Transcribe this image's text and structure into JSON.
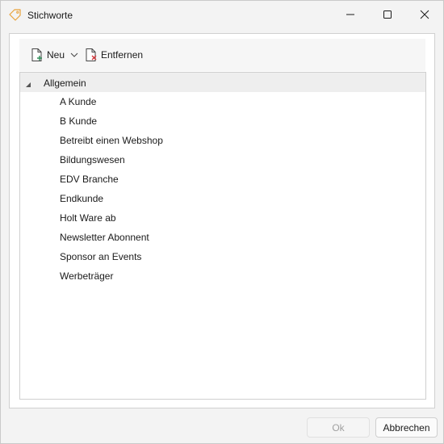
{
  "window": {
    "title": "Stichworte",
    "colors": {
      "title_icon": "#e8a13a",
      "remove_icon_x": "#d13438",
      "new_icon_plus": "#2e8b57"
    }
  },
  "toolbar": {
    "new_label": "Neu",
    "remove_label": "Entfernen"
  },
  "tree": {
    "root_label": "Allgemein",
    "items": [
      "A Kunde",
      "B Kunde",
      "Betreibt einen Webshop",
      "Bildungswesen",
      "EDV Branche",
      "Endkunde",
      "Holt Ware ab",
      "Newsletter Abonnent",
      "Sponsor an Events",
      "Werbeträger"
    ]
  },
  "footer": {
    "ok_label": "Ok",
    "cancel_label": "Abbrechen"
  }
}
